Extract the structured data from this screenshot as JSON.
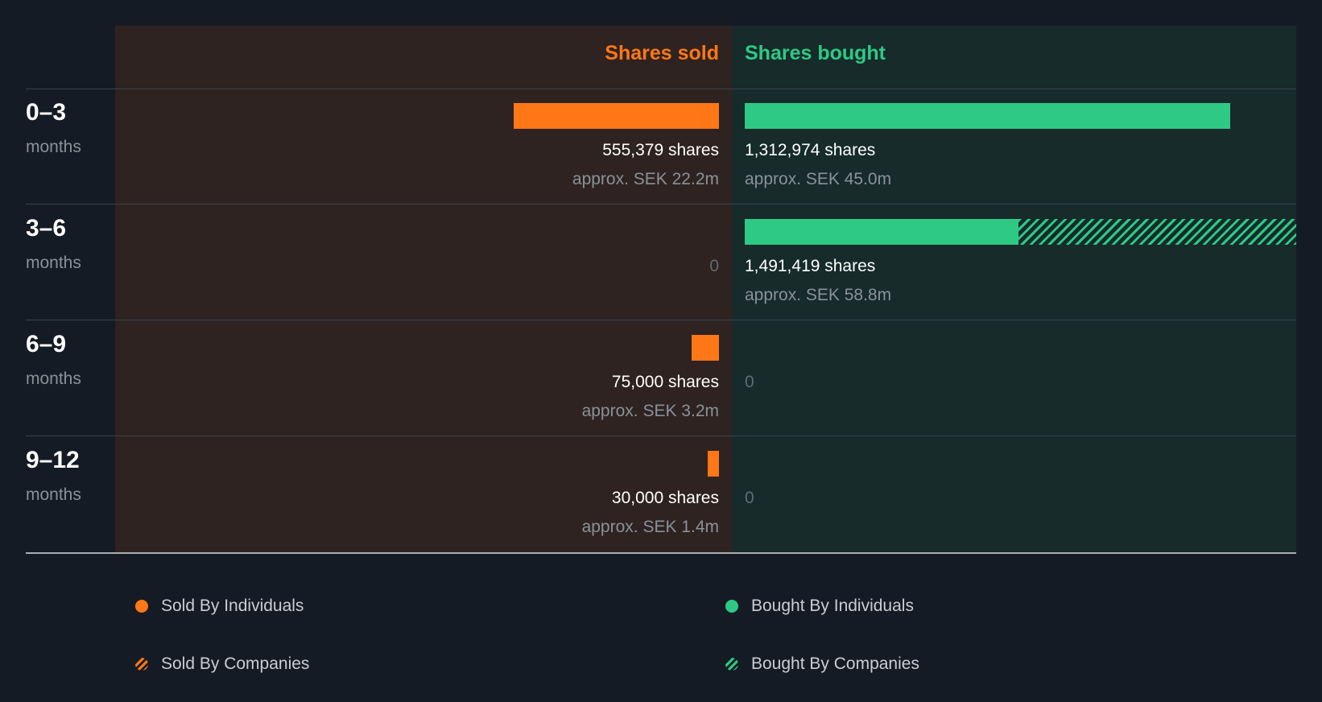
{
  "headers": {
    "sold": "Shares sold",
    "bought": "Shares bought"
  },
  "colors": {
    "sold": "#ff7717",
    "bought": "#2ec985",
    "sold_panel": "#2e2320",
    "bought_panel": "#162b2a",
    "background": "#151b24"
  },
  "rows": [
    {
      "period": "0–3",
      "unit": "months",
      "sold": {
        "shares_label": "555,379 shares",
        "value_label": "approx. SEK 22.2m"
      },
      "bought": {
        "shares_label": "1,312,974 shares",
        "value_label": "approx. SEK 45.0m"
      }
    },
    {
      "period": "3–6",
      "unit": "months",
      "sold": {
        "zero_label": "0"
      },
      "bought": {
        "shares_label": "1,491,419 shares",
        "value_label": "approx. SEK 58.8m"
      }
    },
    {
      "period": "6–9",
      "unit": "months",
      "sold": {
        "shares_label": "75,000 shares",
        "value_label": "approx. SEK 3.2m"
      },
      "bought": {
        "zero_label": "0"
      }
    },
    {
      "period": "9–12",
      "unit": "months",
      "sold": {
        "shares_label": "30,000 shares",
        "value_label": "approx. SEK 1.4m"
      },
      "bought": {
        "zero_label": "0"
      }
    }
  ],
  "legend": [
    {
      "label": "Sold By Individuals",
      "color": "#ff7717",
      "pattern": "solid"
    },
    {
      "label": "Bought By Individuals",
      "color": "#2ec985",
      "pattern": "solid"
    },
    {
      "label": "Sold By Companies",
      "color": "#ff7717",
      "pattern": "hatched"
    },
    {
      "label": "Bought By Companies",
      "color": "#2ec985",
      "pattern": "hatched"
    }
  ],
  "chart_data": {
    "type": "bar",
    "categories": [
      "0–3 months",
      "3–6 months",
      "6–9 months",
      "9–12 months"
    ],
    "series": [
      {
        "name": "Sold By Individuals",
        "values": [
          555379,
          0,
          75000,
          30000
        ]
      },
      {
        "name": "Sold By Companies",
        "values": [
          0,
          0,
          0,
          0
        ]
      },
      {
        "name": "Bought By Individuals",
        "values": [
          1312974,
          740000,
          0,
          0
        ]
      },
      {
        "name": "Bought By Companies",
        "values": [
          0,
          751419,
          0,
          0
        ]
      }
    ],
    "sold_totals": [
      555379,
      0,
      75000,
      30000
    ],
    "bought_totals": [
      1312974,
      1491419,
      0,
      0
    ],
    "xlim": [
      0,
      1491419
    ],
    "legend_position": "bottom"
  }
}
